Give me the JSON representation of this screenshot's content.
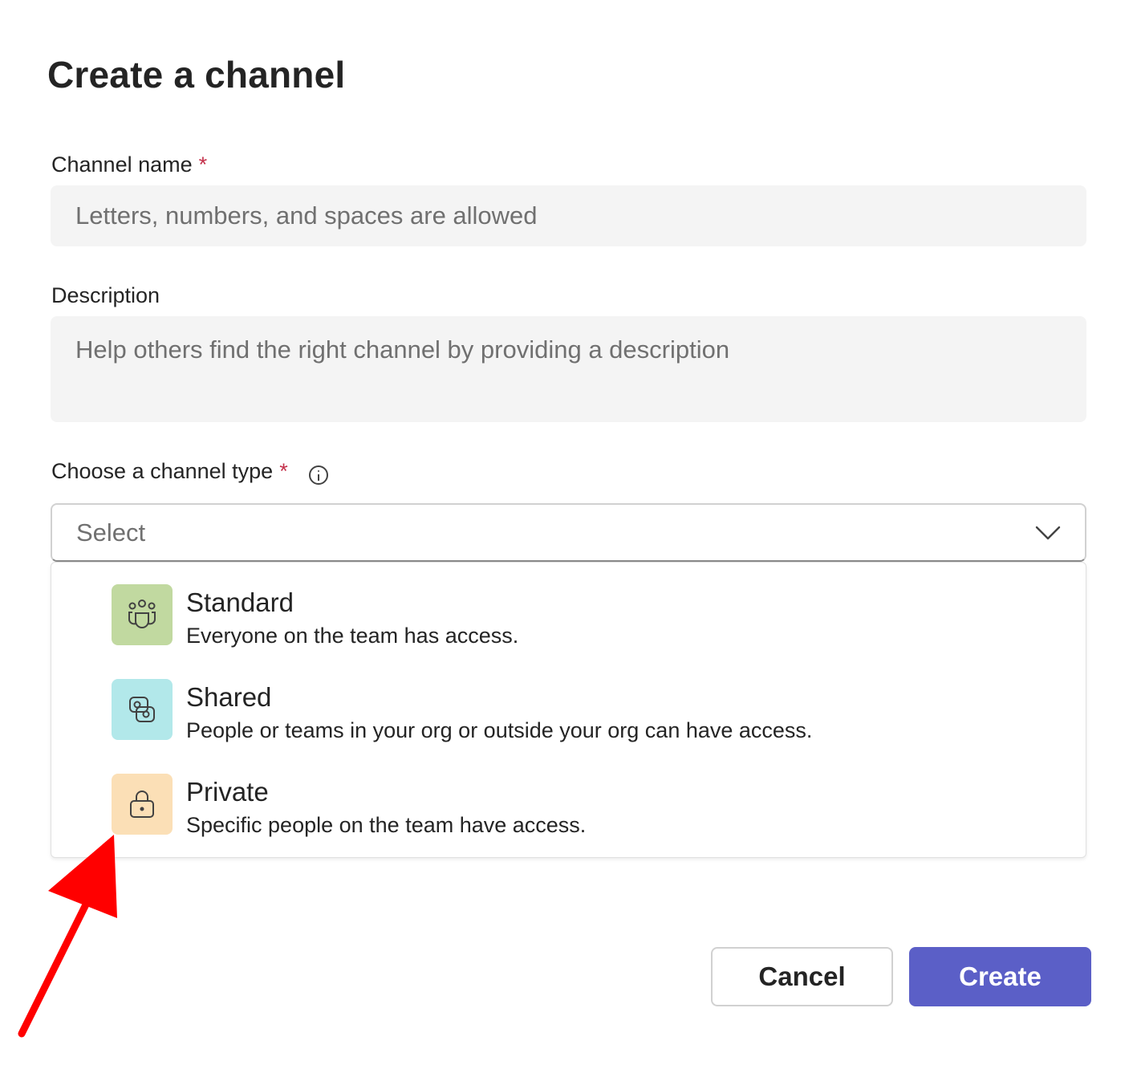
{
  "dialog": {
    "title": "Create a channel"
  },
  "fields": {
    "name_label": "Channel name",
    "name_required": "*",
    "name_placeholder": "Letters, numbers, and spaces are allowed",
    "description_label": "Description",
    "description_placeholder": "Help others find the right channel by providing a description",
    "type_label": "Choose a channel type",
    "type_required": "*"
  },
  "select": {
    "value": "Select",
    "options": [
      {
        "name": "Standard",
        "description": "Everyone on the team has access.",
        "icon": "people-team-icon",
        "color": "#c1d9a0"
      },
      {
        "name": "Shared",
        "description": "People or teams in your org or outside your org can have access.",
        "icon": "shared-link-icon",
        "color": "#b2e8ea"
      },
      {
        "name": "Private",
        "description": "Specific people on the team have access.",
        "icon": "lock-icon",
        "color": "#fbdfb6"
      }
    ]
  },
  "buttons": {
    "cancel_label": "Cancel",
    "create_label": "Create",
    "create_color": "#5b5fc7"
  },
  "annotation": {
    "arrow_color": "#ff0000",
    "target": "Private"
  }
}
